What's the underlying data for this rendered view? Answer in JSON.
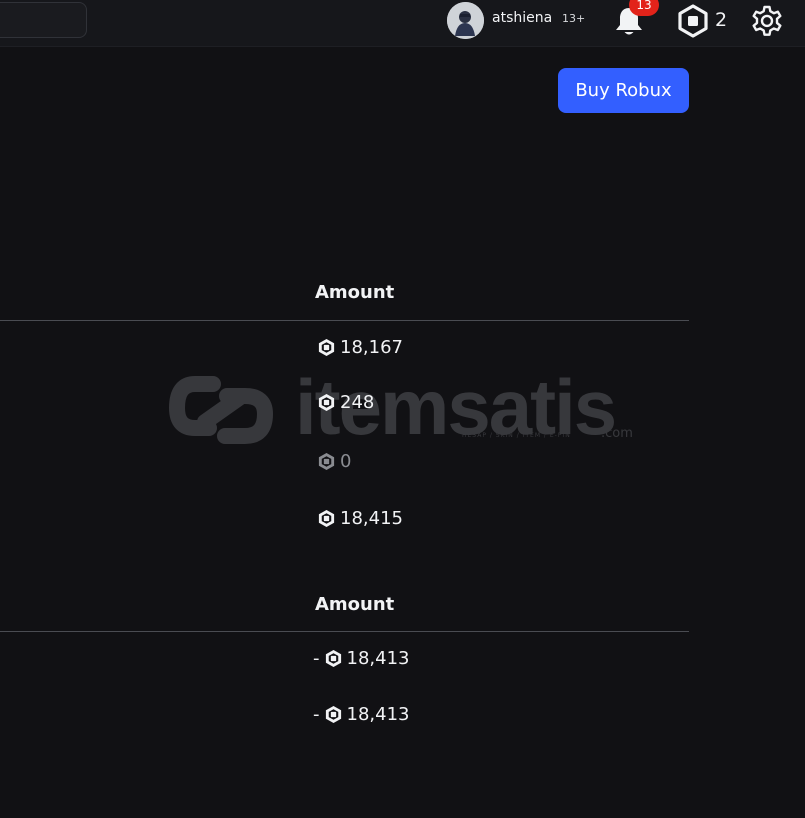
{
  "header": {
    "username": "atshiena",
    "age_badge": "13+",
    "notifications_count": "13",
    "robux_balance": "2"
  },
  "buy_button_label": "Buy Robux",
  "incoming_table": {
    "header": "Amount",
    "rows": [
      {
        "amount": "18,167",
        "muted": false
      },
      {
        "amount": "248",
        "muted": false
      },
      {
        "amount": "0",
        "muted": true
      },
      {
        "amount": "18,415",
        "muted": false
      }
    ]
  },
  "outgoing_table": {
    "header": "Amount",
    "rows": [
      {
        "prefix": "-",
        "amount": "18,413"
      },
      {
        "prefix": "-",
        "amount": "18,413"
      }
    ]
  },
  "watermark": {
    "text": "itemsatis",
    "subtext": "HESAP / SKIN / ITEM / E-PIN",
    "suffix": ".com"
  },
  "icons": [
    "bell-icon",
    "robux-icon",
    "gear-icon",
    "avatar"
  ],
  "colors": {
    "accent": "#335fff",
    "badge": "#e2231a",
    "background": "#111114"
  }
}
